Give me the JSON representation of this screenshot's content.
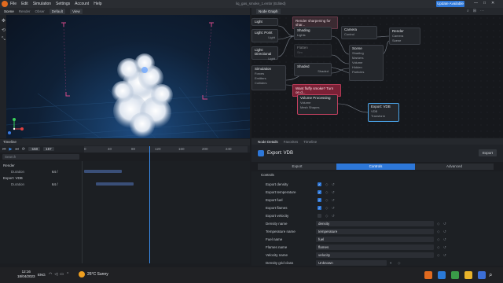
{
  "app": {
    "menu": [
      "File",
      "Edit",
      "Simulation",
      "Settings",
      "Account",
      "Help"
    ],
    "doc_title": "liq_gas_smoke_1.embr (Edited)",
    "update_button": "Update Available"
  },
  "viewport": {
    "tabs": [
      "Scene",
      "Render",
      "Obser"
    ],
    "dropdowns": [
      "Default",
      "View"
    ]
  },
  "timeline": {
    "title": "Timeline",
    "frame_start": "-150",
    "frame_current": "157",
    "ruler_ticks": [
      "0",
      "40",
      "80",
      "120",
      "160",
      "200",
      "240"
    ],
    "search_placeholder": "Search",
    "tracks": [
      {
        "name": "Render",
        "sub": "Duration",
        "value": "64 /"
      },
      {
        "name": "Export: VDB",
        "sub": "Duration",
        "value": "64 /"
      }
    ]
  },
  "node_graph": {
    "tab": "Node Graph",
    "notes": {
      "sharpen": "Render sharpening for shar...",
      "fluffy": "Want fluffy smoke? Turn on d..."
    },
    "nodes": {
      "light": {
        "title": "Light",
        "out": "Light"
      },
      "point": {
        "title": "Light: Point",
        "out": "Light"
      },
      "directional": {
        "title": "Light: Directional",
        "out": "Light"
      },
      "simulation": {
        "title": "Simulation",
        "ports": [
          "Forces",
          "Emitters",
          "Colliders"
        ],
        "outs": [
          "Volume",
          "Particles"
        ]
      },
      "shading": {
        "title": "Shading",
        "in": "Lights",
        "out": "Shading"
      },
      "flatten": {
        "title": "Flatten",
        "in": "Sim",
        "out": "Shading"
      },
      "shaded": {
        "title": "Shaded",
        "out": "Shaded"
      },
      "camera": {
        "title": "Camera",
        "in": "Control",
        "out": "Camera"
      },
      "scene": {
        "title": "Scene",
        "ports": [
          "Shading",
          "Markers",
          "Volume",
          "Hidden",
          "Particles"
        ],
        "out": "Scene"
      },
      "render": {
        "title": "Render",
        "ports": [
          "Camera",
          "Scene"
        ]
      },
      "volproc": {
        "title": "Volume Processing",
        "in": "Volume",
        "out": "Volume",
        "in2": "Mesh Shapes",
        "out2": "VDB"
      },
      "export": {
        "title": "Export: VDB",
        "ports": [
          "VDB",
          "Transform"
        ]
      }
    }
  },
  "details": {
    "tabs": [
      "Node Details",
      "Favorites",
      "Timeline"
    ],
    "title": "Export: VDB",
    "export_button": "Export",
    "subtabs": [
      "Export",
      "Controls",
      "Advanced"
    ],
    "section": "Controls",
    "checks": [
      {
        "label": "Export density",
        "checked": true
      },
      {
        "label": "Export temperature",
        "checked": true
      },
      {
        "label": "Export fuel",
        "checked": true
      },
      {
        "label": "Export flames",
        "checked": true
      },
      {
        "label": "Export velocity",
        "checked": false
      }
    ],
    "fields": [
      {
        "label": "Density name",
        "value": "density"
      },
      {
        "label": "Temperature name",
        "value": "temperature"
      },
      {
        "label": "Fuel name",
        "value": "fuel"
      },
      {
        "label": "Flames name",
        "value": "flames"
      },
      {
        "label": "Velocity name",
        "value": "velocity"
      },
      {
        "label": "Density grid class",
        "value": "Unknown"
      }
    ]
  },
  "taskbar": {
    "time": "12:16",
    "date": "18/04/2023",
    "lang": "ENG",
    "weather": "26°C  Sunny"
  }
}
